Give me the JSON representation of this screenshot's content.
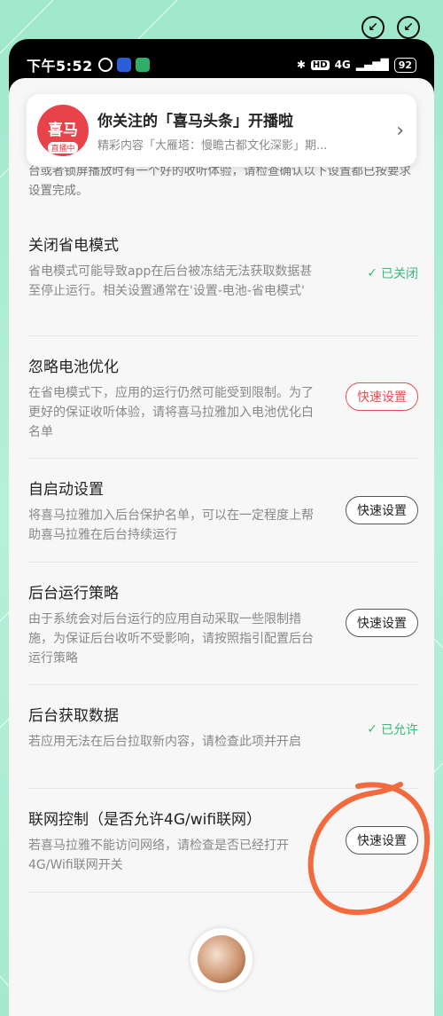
{
  "status_bar": {
    "time": "下午5:52",
    "network": "4G",
    "battery": "92"
  },
  "banner": {
    "logo_text": "喜马",
    "logo_badge": "直播中",
    "title": "你关注的「喜马头条」开播啦",
    "subtitle": "精彩内容「大雁塔：慢瞻古都文化深影」期..."
  },
  "intro_text": "台或者锁屏播放时有一个好的收听体验，请检查确认以下设置都已按要求设置完成。",
  "items": [
    {
      "title": "关闭省电模式",
      "desc": "省电模式可能导致app在后台被冻结无法获取数据甚至停止运行。相关设置通常在'设置-电池-省电模式'",
      "status": "已关闭"
    },
    {
      "title": "忽略电池优化",
      "desc": "在省电模式下，应用的运行仍然可能受到限制。为了更好的保证收听体验，请将喜马拉雅加入电池优化白名单",
      "button": "快速设置"
    },
    {
      "title": "自启动设置",
      "desc": "将喜马拉雅加入后台保护名单，可以在一定程度上帮助喜马拉雅在后台持续运行",
      "button": "快速设置"
    },
    {
      "title": "后台运行策略",
      "desc": "由于系统会对后台运行的应用自动采取一些限制措施，为保证后台收听不受影响，请按照指引配置后台运行策略",
      "button": "快速设置"
    },
    {
      "title": "后台获取数据",
      "desc": "若应用无法在后台拉取新内容，请检查此项并开启",
      "status": "已允许"
    },
    {
      "title": "联网控制（是否允许4G/wifi联网）",
      "desc": "若喜马拉雅不能访问网络，请检查是否已经打开4G/Wifi联网开关",
      "button": "快速设置"
    }
  ],
  "colors": {
    "accent_red": "#e25050",
    "ok_green": "#3cb878",
    "annotation_orange": "#f26a3d"
  }
}
